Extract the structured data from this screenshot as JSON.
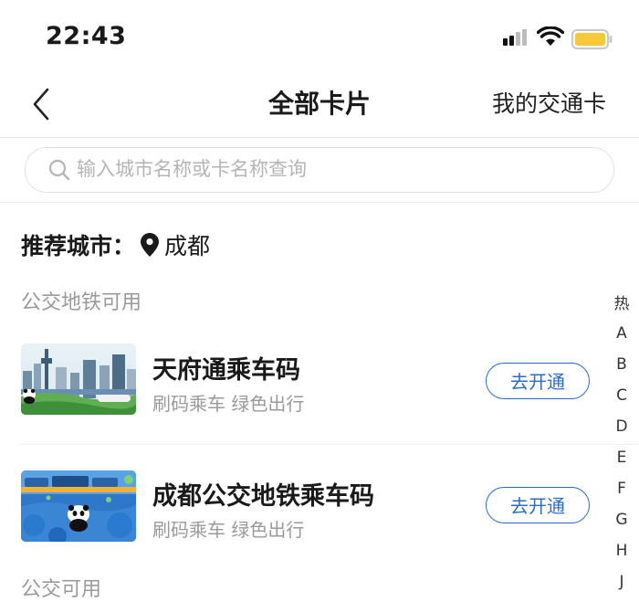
{
  "status_bar": {
    "time": "22:43"
  },
  "nav": {
    "title": "全部卡片",
    "right_link": "我的交通卡"
  },
  "search": {
    "placeholder": "输入城市名称或卡名称查询"
  },
  "recommended": {
    "label": "推荐城市：",
    "city": "成都"
  },
  "sections": [
    {
      "label": "公交地铁可用",
      "cards": [
        {
          "name": "天府通乘车码",
          "subtitle": "刷码乘车 绿色出行",
          "button": "去开通"
        },
        {
          "name": "成都公交地铁乘车码",
          "subtitle": "刷码乘车 绿色出行",
          "button": "去开通"
        }
      ]
    },
    {
      "label": "公交可用",
      "cards": []
    }
  ],
  "index_bar": [
    "热",
    "A",
    "B",
    "C",
    "D",
    "E",
    "F",
    "G",
    "H",
    "J"
  ],
  "colors": {
    "accent": "#2b6cc7",
    "battery": "#f5c93a"
  }
}
